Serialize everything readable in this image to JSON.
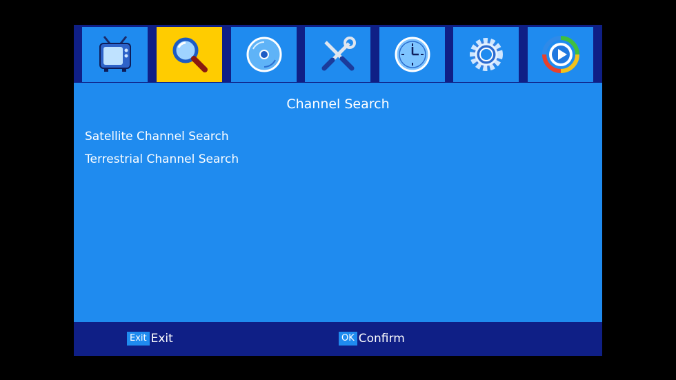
{
  "colors": {
    "frame": "#0f1f86",
    "panel": "#1f8bef",
    "active_tab": "#ffcc00",
    "text": "#ffffff"
  },
  "tabs": [
    {
      "icon": "tv-icon",
      "active": false
    },
    {
      "icon": "search-magnifier-icon",
      "active": true
    },
    {
      "icon": "disc-icon",
      "active": false
    },
    {
      "icon": "tools-icon",
      "active": false
    },
    {
      "icon": "clock-icon",
      "active": false
    },
    {
      "icon": "gear-icon",
      "active": false
    },
    {
      "icon": "media-play-icon",
      "active": false
    }
  ],
  "page": {
    "title": "Channel Search"
  },
  "menu": {
    "items": [
      {
        "label": "Satellite Channel Search"
      },
      {
        "label": "Terrestrial Channel Search"
      }
    ]
  },
  "footer": {
    "exit_key": "Exit",
    "exit_label": "Exit",
    "ok_key": "OK",
    "ok_label": "Confirm"
  }
}
